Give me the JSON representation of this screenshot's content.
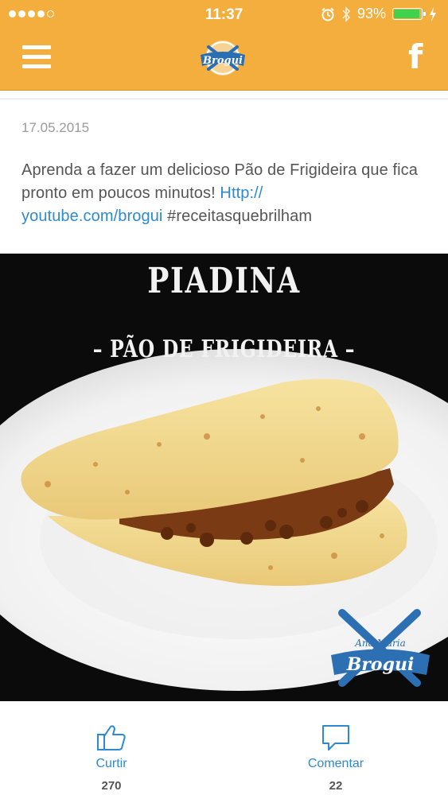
{
  "status_bar": {
    "time": "11:37",
    "battery_percent": "93%",
    "battery_level": 0.93,
    "signal_bars": 4,
    "signal_max": 5,
    "icons": [
      "alarm-icon",
      "bluetooth-icon",
      "charging-icon"
    ]
  },
  "nav": {
    "menu_icon": "hamburger-menu-icon",
    "logo_text": "Brogui",
    "share_icon": "facebook-icon"
  },
  "post": {
    "date": "17.05.2015",
    "text_plain": "Aprenda a fazer um delicioso Pão de Frigideira que fica pronto em poucos minutos! ",
    "link_text": "Http://\nyoutube.com/brogui",
    "hashtag": " #receitasquebrilham",
    "image": {
      "title": "PIADINA",
      "subtitle": "– PÃO DE FRIGIDEIRA –",
      "watermark_line1": "Ana Maria",
      "watermark_line2": "Brogui"
    }
  },
  "actions": {
    "like_label": "Curtir",
    "like_count": "270",
    "comment_label": "Comentar",
    "comment_count": "22"
  },
  "colors": {
    "header": "#f3ae3d",
    "link": "#2f89d1",
    "battery_fill": "#3fd24f"
  }
}
